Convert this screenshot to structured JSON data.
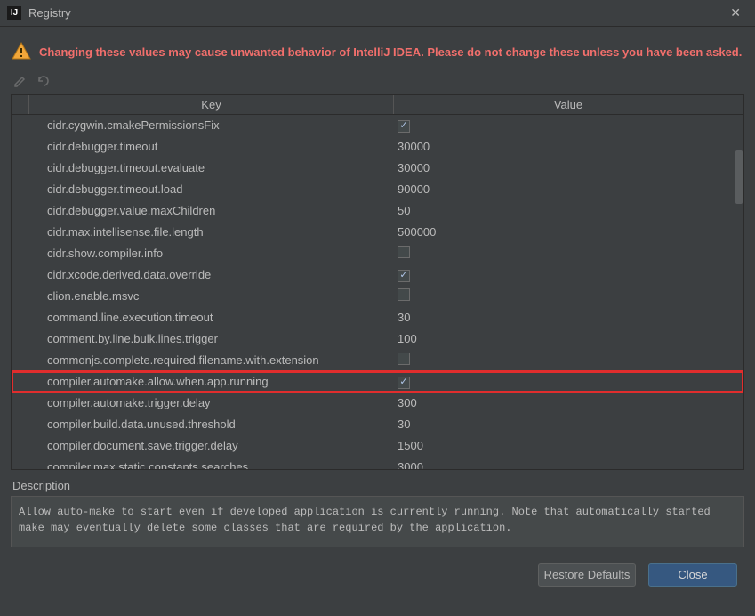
{
  "window": {
    "title": "Registry"
  },
  "warning": "Changing these values may cause unwanted behavior of IntelliJ IDEA. Please do not change these unless you have been asked.",
  "table": {
    "headers": {
      "key": "Key",
      "value": "Value"
    },
    "rows": [
      {
        "key": "cidr.cygwin.cmakePermissionsFix",
        "type": "checkbox",
        "value": true,
        "highlight": false
      },
      {
        "key": "cidr.debugger.timeout",
        "type": "text",
        "value": "30000",
        "highlight": false
      },
      {
        "key": "cidr.debugger.timeout.evaluate",
        "type": "text",
        "value": "30000",
        "highlight": false
      },
      {
        "key": "cidr.debugger.timeout.load",
        "type": "text",
        "value": "90000",
        "highlight": false
      },
      {
        "key": "cidr.debugger.value.maxChildren",
        "type": "text",
        "value": "50",
        "highlight": false
      },
      {
        "key": "cidr.max.intellisense.file.length",
        "type": "text",
        "value": "500000",
        "highlight": false
      },
      {
        "key": "cidr.show.compiler.info",
        "type": "checkbox",
        "value": false,
        "highlight": false
      },
      {
        "key": "cidr.xcode.derived.data.override",
        "type": "checkbox",
        "value": true,
        "highlight": false
      },
      {
        "key": "clion.enable.msvc",
        "type": "checkbox",
        "value": false,
        "highlight": false
      },
      {
        "key": "command.line.execution.timeout",
        "type": "text",
        "value": "30",
        "highlight": false
      },
      {
        "key": "comment.by.line.bulk.lines.trigger",
        "type": "text",
        "value": "100",
        "highlight": false
      },
      {
        "key": "commonjs.complete.required.filename.with.extension",
        "type": "checkbox",
        "value": false,
        "highlight": false
      },
      {
        "key": "compiler.automake.allow.when.app.running",
        "type": "checkbox",
        "value": true,
        "highlight": true
      },
      {
        "key": "compiler.automake.trigger.delay",
        "type": "text",
        "value": "300",
        "highlight": false
      },
      {
        "key": "compiler.build.data.unused.threshold",
        "type": "text",
        "value": "30",
        "highlight": false
      },
      {
        "key": "compiler.document.save.trigger.delay",
        "type": "text",
        "value": "1500",
        "highlight": false
      },
      {
        "key": "compiler.max.static.constants.searches",
        "type": "text",
        "value": "3000",
        "highlight": false
      }
    ]
  },
  "description": {
    "label": "Description",
    "text": "Allow auto-make to start even if developed application is currently running. Note that automatically started make may eventually delete some classes that are required by the application."
  },
  "buttons": {
    "restore": "Restore Defaults",
    "close": "Close"
  }
}
